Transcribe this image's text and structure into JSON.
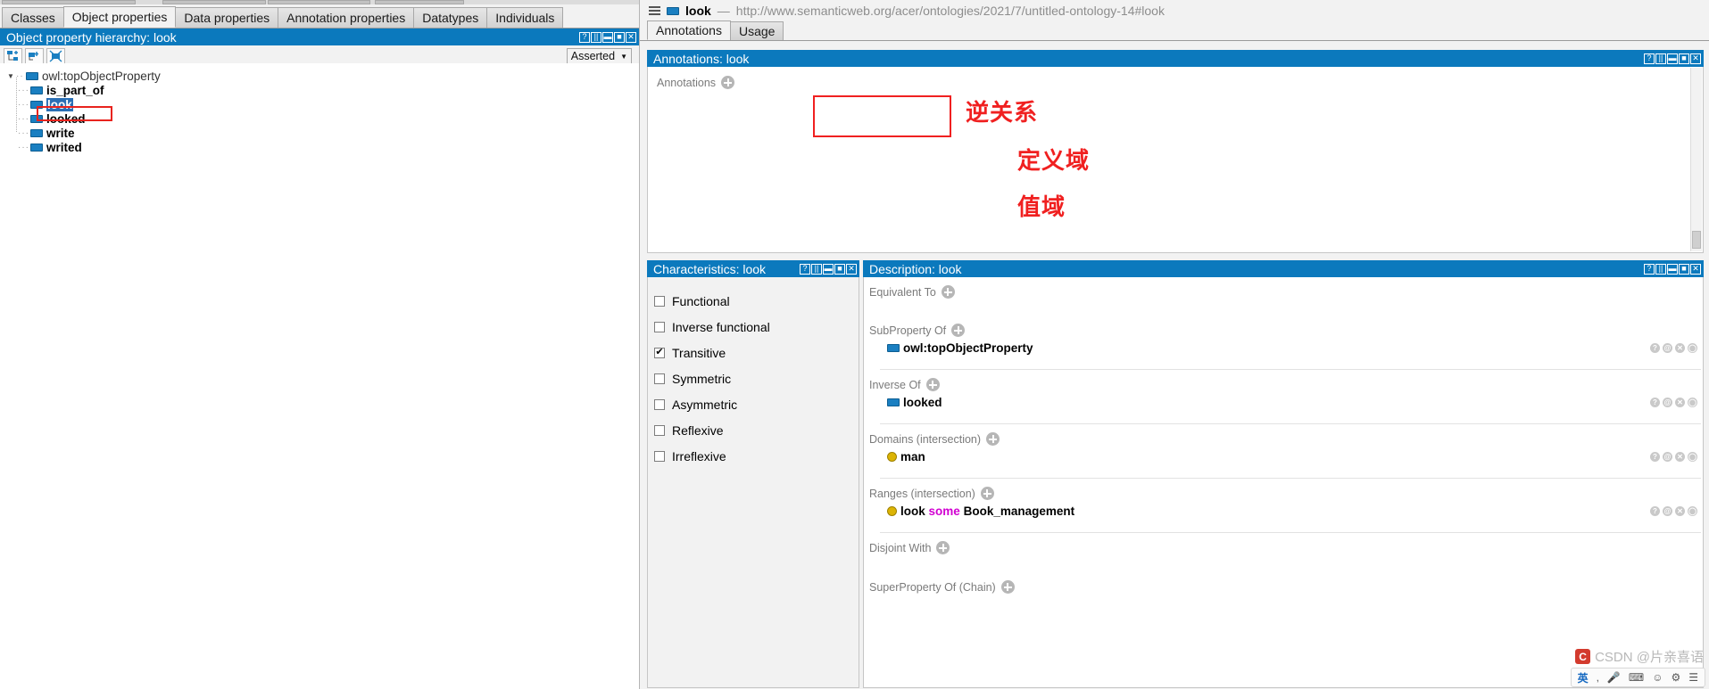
{
  "tabs": [
    {
      "label": "Classes",
      "active": false
    },
    {
      "label": "Object properties",
      "active": true
    },
    {
      "label": "Data properties",
      "active": false
    },
    {
      "label": "Annotation properties",
      "active": false
    },
    {
      "label": "Datatypes",
      "active": false
    },
    {
      "label": "Individuals",
      "active": false
    }
  ],
  "hierarchy_panel": {
    "title": "Object property hierarchy: look",
    "toolbar": {
      "add_sibling_icon": "add-sibling-icon",
      "add_child_icon": "add-child-icon",
      "delete_icon": "delete-property-icon"
    },
    "asserted_label": "Asserted",
    "tree": [
      {
        "label": "owl:topObjectProperty",
        "level": 0,
        "icon": "object-property-icon",
        "expanded": true,
        "selected": false
      },
      {
        "label": "is_part_of",
        "level": 1,
        "icon": "object-property-icon",
        "selected": false
      },
      {
        "label": "look",
        "level": 1,
        "icon": "object-property-icon",
        "selected": true
      },
      {
        "label": "looked",
        "level": 1,
        "icon": "object-property-icon",
        "selected": false
      },
      {
        "label": "write",
        "level": 1,
        "icon": "object-property-icon",
        "selected": false
      },
      {
        "label": "writed",
        "level": 1,
        "icon": "object-property-icon",
        "selected": false
      }
    ]
  },
  "iri_bar": {
    "menu_icon": "hamburger-icon",
    "entity_icon": "object-property-icon",
    "name": "look",
    "separator": "—",
    "url": "http://www.semanticweb.org/acer/ontologies/2021/7/untitled-ontology-14#look"
  },
  "sub_tabs": [
    {
      "label": "Annotations",
      "active": true
    },
    {
      "label": "Usage",
      "active": false
    }
  ],
  "annotations_panel": {
    "title": "Annotations: look",
    "section_label": "Annotations",
    "add_icon": "plus-icon"
  },
  "characteristics_panel": {
    "title": "Characteristics: look",
    "items": [
      {
        "label": "Functional",
        "checked": false
      },
      {
        "label": "Inverse functional",
        "checked": false
      },
      {
        "label": "Transitive",
        "checked": true
      },
      {
        "label": "Symmetric",
        "checked": false
      },
      {
        "label": "Asymmetric",
        "checked": false
      },
      {
        "label": "Reflexive",
        "checked": false
      },
      {
        "label": "Irreflexive",
        "checked": false
      }
    ]
  },
  "description_panel": {
    "title": "Description: look",
    "sections": [
      {
        "label": "Equivalent To",
        "add_icon": "plus-icon",
        "items": []
      },
      {
        "label": "SubProperty Of",
        "add_icon": "plus-icon",
        "items": [
          {
            "text": "owl:topObjectProperty",
            "icon": "object-property-icon",
            "row_buttons": [
              "?",
              "@",
              "x",
              "o"
            ]
          }
        ]
      },
      {
        "label": "Inverse Of",
        "add_icon": "plus-icon",
        "items": [
          {
            "text": "looked",
            "icon": "object-property-icon",
            "row_buttons": [
              "?",
              "@",
              "x",
              "o"
            ]
          }
        ]
      },
      {
        "label": "Domains (intersection)",
        "add_icon": "plus-icon",
        "items": [
          {
            "text": "man",
            "icon": "class-icon",
            "row_buttons": [
              "?",
              "@",
              "x",
              "o"
            ]
          }
        ]
      },
      {
        "label": "Ranges (intersection)",
        "add_icon": "plus-icon",
        "items": [
          {
            "text": "look some Book_management",
            "icon": "class-icon",
            "parts": [
              {
                "t": "look",
                "style": "entity"
              },
              {
                "t": "some",
                "style": "keyword"
              },
              {
                "t": "Book_management",
                "style": "entity"
              }
            ],
            "row_buttons": [
              "?",
              "@",
              "x",
              "o"
            ]
          }
        ]
      },
      {
        "label": "Disjoint With",
        "add_icon": "plus-icon",
        "items": []
      },
      {
        "label": "SuperProperty Of (Chain)",
        "add_icon": "plus-icon",
        "items": []
      }
    ]
  },
  "annotations_red": [
    {
      "text": "逆关系",
      "meaning": "inverse-relation"
    },
    {
      "text": "定义域",
      "meaning": "domain"
    },
    {
      "text": "值域",
      "meaning": "range"
    }
  ],
  "watermark": {
    "text": "CSDN @片亲喜语",
    "logo": "csdn-logo-icon"
  },
  "ime_bar": {
    "lang": "英",
    "items": [
      "ime-punctuation-icon",
      "ime-mic-icon",
      "ime-keyboard-icon",
      "ime-emoji-icon",
      "ime-tools-icon",
      "ime-settings-icon"
    ]
  },
  "panel_buttons": [
    "?",
    "||",
    "—",
    "▣",
    "✕"
  ],
  "colors": {
    "panel_header": "#0b79bd",
    "selection": "#2a6fb5",
    "annotation_red": "#f02020",
    "keyword": "#d100d1",
    "object_property": "#1a7fc1",
    "class": "#dcb404"
  }
}
